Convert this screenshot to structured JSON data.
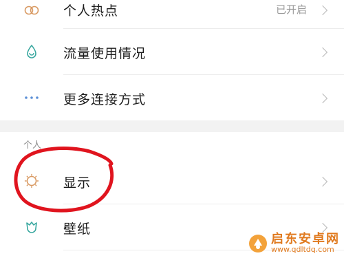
{
  "settings": {
    "rows": [
      {
        "label": "个人热点",
        "value": "已开启",
        "icon": "hotspot-icon"
      },
      {
        "label": "流量使用情况",
        "value": "",
        "icon": "data-usage-icon"
      },
      {
        "label": "更多连接方式",
        "value": "",
        "icon": "more-connections-icon"
      }
    ],
    "section_personal": {
      "title": "个人",
      "rows": [
        {
          "label": "显示",
          "icon": "brightness-icon"
        },
        {
          "label": "壁纸",
          "icon": "wallpaper-icon"
        }
      ]
    }
  },
  "watermark": {
    "name": "启东安卓网",
    "url": "www.qdltdq.com"
  },
  "colors": {
    "annotation": "#e0141e",
    "teal": "#3aa8a0",
    "orange": "#d99a63",
    "blue": "#5b8fd6"
  }
}
